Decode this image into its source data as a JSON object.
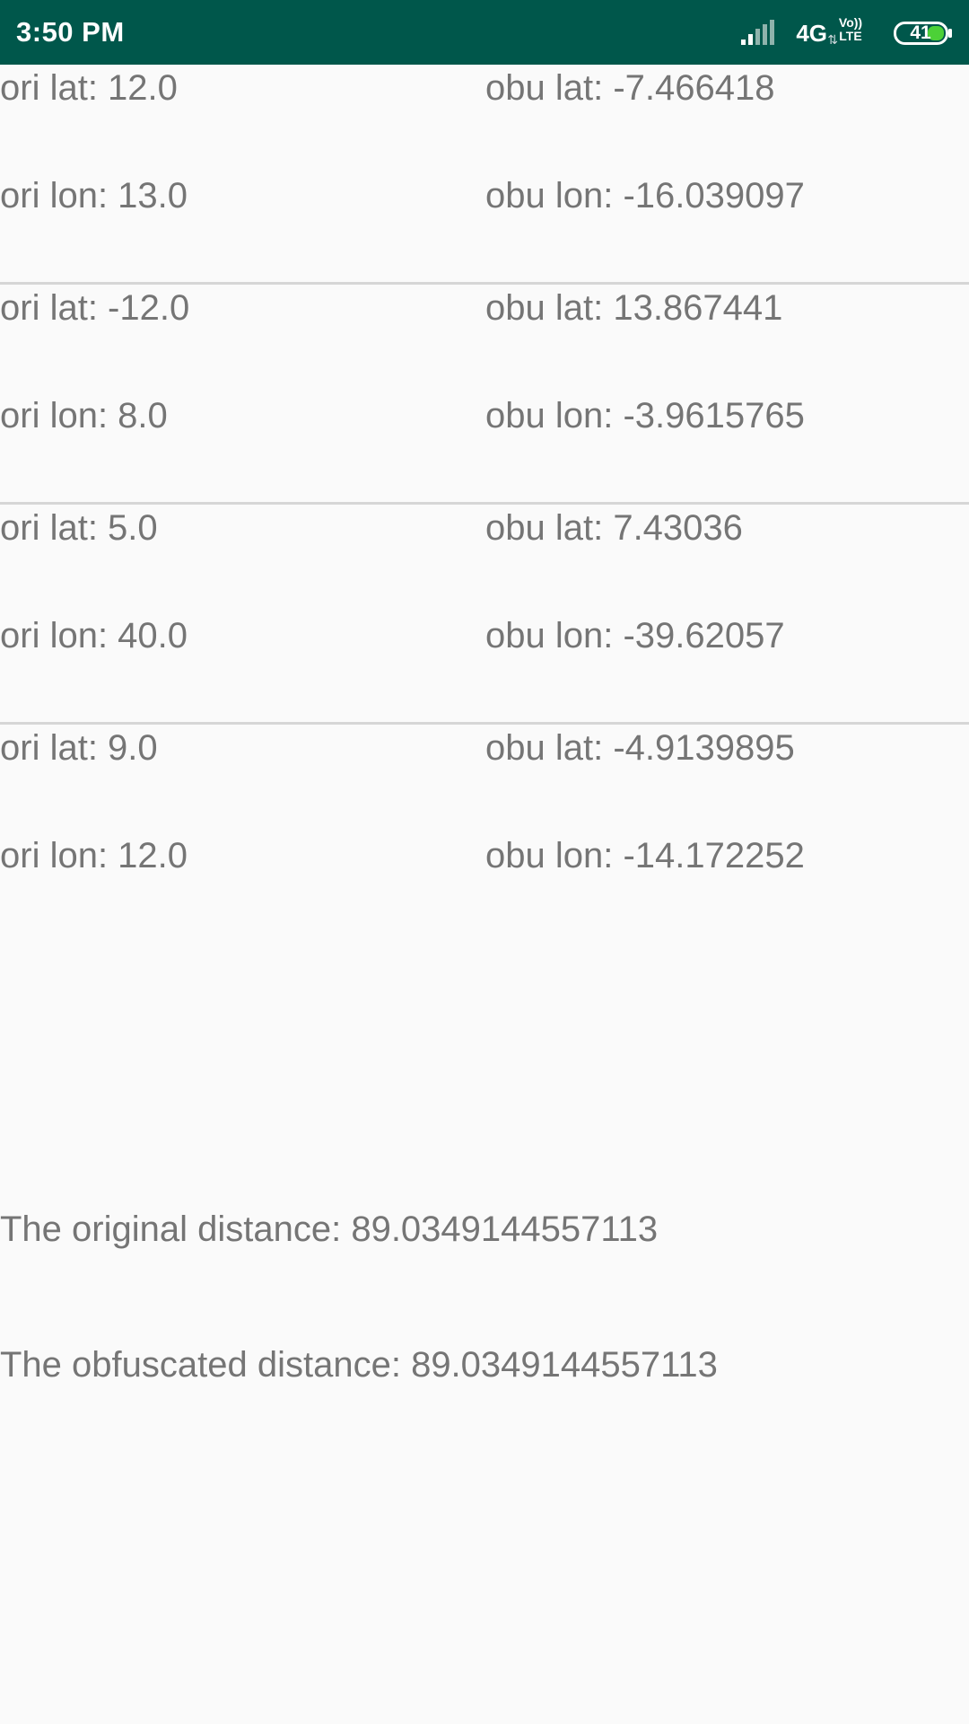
{
  "status_bar": {
    "time": "3:50 PM",
    "network": "4G",
    "volte": [
      "Vo))",
      "LTE"
    ],
    "battery": "41",
    "icons": [
      "signal-icon",
      "volte-icon",
      "battery-icon"
    ],
    "background_color": "#00574b"
  },
  "coordinates": [
    {
      "ori_lat": "ori lat: 12.0",
      "ori_lon": "ori lon: 13.0",
      "obu_lat": "obu lat: -7.466418",
      "obu_lon": "obu lon: -16.039097"
    },
    {
      "ori_lat": "ori lat: -12.0",
      "ori_lon": "ori lon: 8.0",
      "obu_lat": "obu lat: 13.867441",
      "obu_lon": "obu lon: -3.9615765"
    },
    {
      "ori_lat": "ori lat: 5.0",
      "ori_lon": "ori lon: 40.0",
      "obu_lat": "obu lat: 7.43036",
      "obu_lon": "obu lon: -39.62057"
    },
    {
      "ori_lat": "ori lat: 9.0",
      "ori_lon": "ori lon: 12.0",
      "obu_lat": "obu lat: -4.9139895",
      "obu_lon": "obu lon: -14.172252"
    }
  ],
  "distances": {
    "original": "The original distance: 89.0349144557113",
    "obfuscated": "The obfuscated distance: 89.0349144557113"
  }
}
